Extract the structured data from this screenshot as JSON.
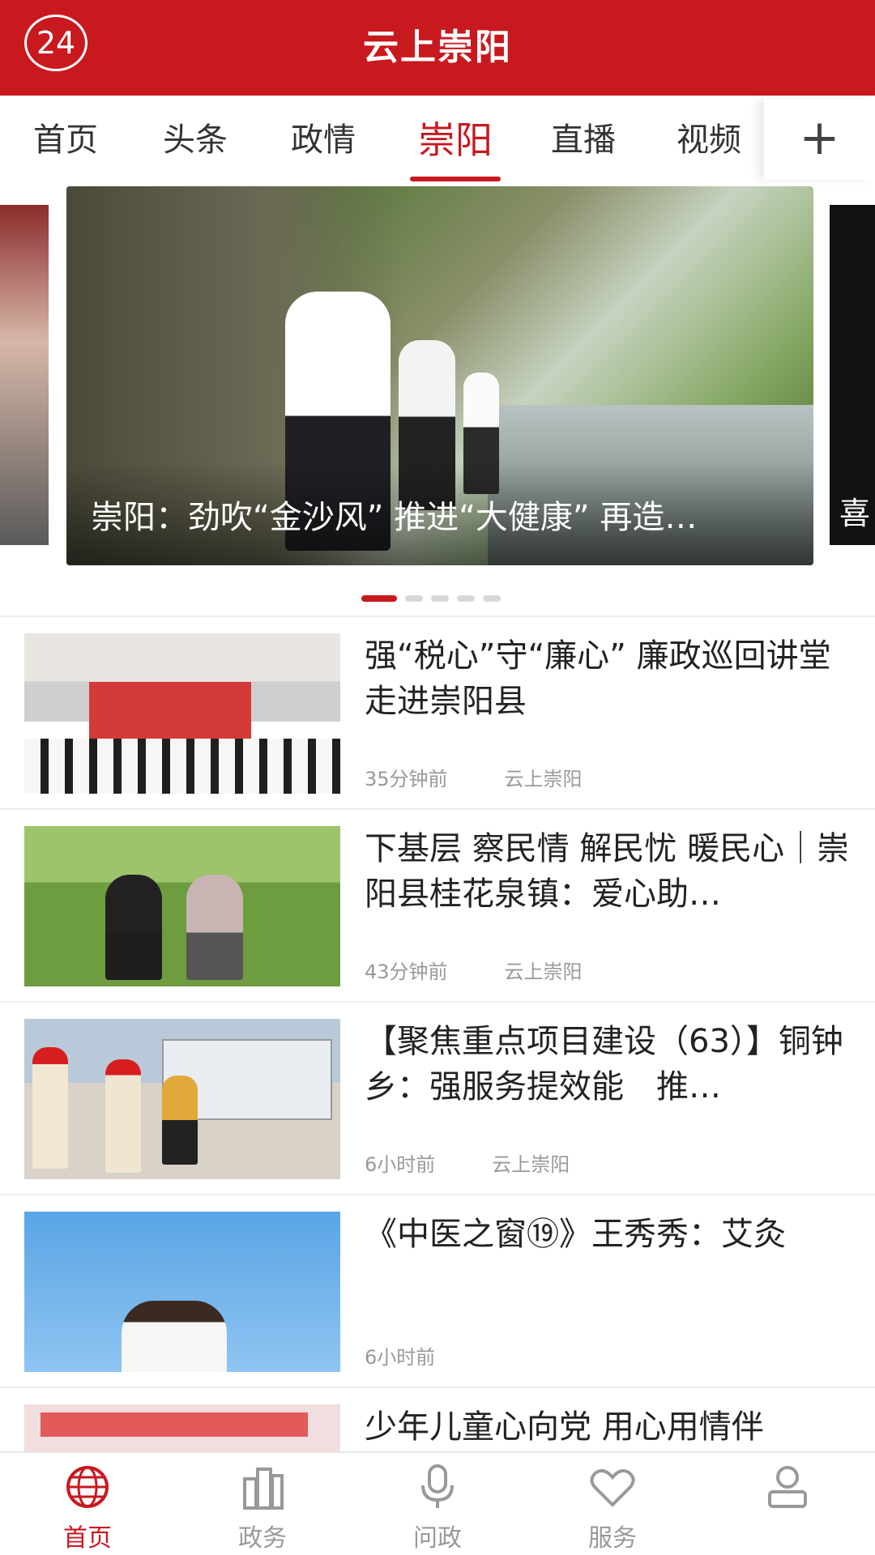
{
  "header": {
    "badge": "24",
    "title": "云上崇阳"
  },
  "tabs": {
    "items": [
      {
        "label": "首页"
      },
      {
        "label": "头条"
      },
      {
        "label": "政情"
      },
      {
        "label": "崇阳"
      },
      {
        "label": "直播"
      },
      {
        "label": "视频"
      }
    ],
    "active_index": 3,
    "add_label": "+"
  },
  "carousel": {
    "caption": "崇阳：劲吹“金沙风” 推进“大健康” 再造…",
    "right_peek_text": "喜",
    "dot_count": 5,
    "active_dot": 0
  },
  "news": [
    {
      "title": "强“税心”守“廉心” 廉政巡回讲堂走进崇阳县",
      "time": "35分钟前",
      "source": "云上崇阳"
    },
    {
      "title": "下基层 察民情 解民忧 暖民心｜崇阳县桂花泉镇：爱心助…",
      "time": "43分钟前",
      "source": "云上崇阳"
    },
    {
      "title": "【聚焦重点项目建设（63）】铜钟乡：强服务提效能　推…",
      "time": "6小时前",
      "source": "云上崇阳"
    },
    {
      "title": "《中医之窗⑲》王秀秀：艾灸",
      "time": "6小时前",
      "source": ""
    },
    {
      "title": "少年儿童心向党 用心用情伴",
      "time": "",
      "source": ""
    }
  ],
  "bottom_nav": {
    "items": [
      {
        "label": "首页",
        "icon": "globe-icon"
      },
      {
        "label": "政务",
        "icon": "buildings-icon"
      },
      {
        "label": "问政",
        "icon": "microphone-icon"
      },
      {
        "label": "服务",
        "icon": "heart-icon"
      },
      {
        "label": "",
        "icon": "user-icon"
      }
    ],
    "active_index": 0
  },
  "colors": {
    "brand_red": "#c8191f"
  }
}
